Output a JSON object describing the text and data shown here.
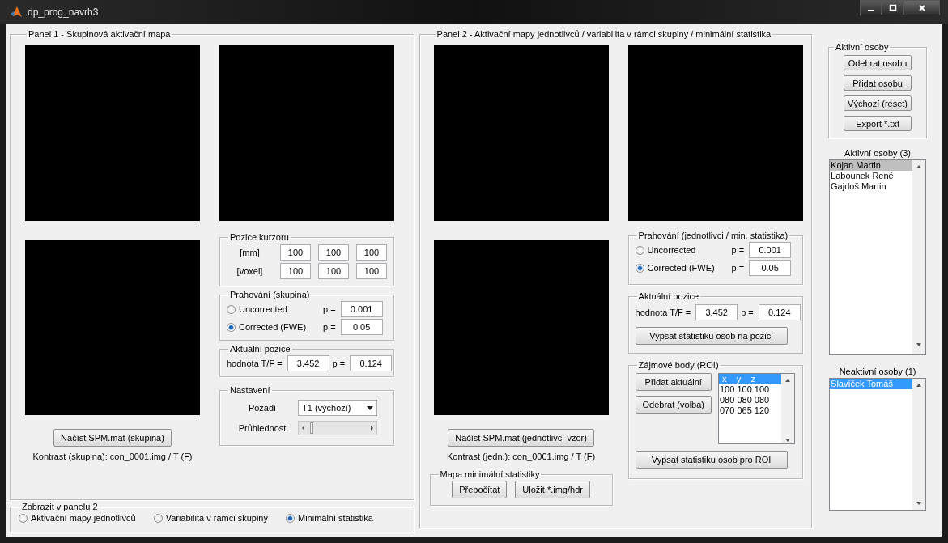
{
  "window": {
    "title": "dp_prog_navrh3"
  },
  "panel1": {
    "title": "Panel 1 - Skupinová aktivační mapa",
    "load_button": "Načíst SPM.mat (skupina)",
    "contrast": "Kontrast (skupina): con_0001.img / T (F)",
    "cursor": {
      "title": "Pozice kurzoru",
      "rows": [
        {
          "label": "[mm]",
          "values": [
            "100",
            "100",
            "100"
          ]
        },
        {
          "label": "[voxel]",
          "values": [
            "100",
            "100",
            "100"
          ]
        }
      ]
    },
    "threshold": {
      "title": "Prahování (skupina)",
      "options": [
        {
          "label": "Uncorrected",
          "selected": false,
          "p_label": "p =",
          "p": "0.001"
        },
        {
          "label": "Corrected (FWE)",
          "selected": true,
          "p_label": "p =",
          "p": "0.05"
        }
      ]
    },
    "current": {
      "title": "Aktuální pozice",
      "value_label": "hodnota T/F =",
      "value": "3.452",
      "p_label": "p =",
      "p": "0.124"
    },
    "settings": {
      "title": "Nastavení",
      "background_label": "Pozadí",
      "background": "T1 (výchozí)",
      "opacity_label": "Průhlednost"
    }
  },
  "display": {
    "title": "Zobrazit v panelu 2",
    "options": [
      {
        "label": "Aktivační mapy jednotlivců",
        "selected": false
      },
      {
        "label": "Variabilita v rámci skupiny",
        "selected": false
      },
      {
        "label": "Minimální statistika",
        "selected": true
      }
    ]
  },
  "panel2": {
    "title": "Panel 2 - Aktivační mapy jednotlivců / variabilita v rámci skupiny / minimální statistika",
    "load_button": "Načíst SPM.mat (jednotlivci-vzor)",
    "contrast": "Kontrast (jedn.): con_0001.img / T (F)",
    "min_map": {
      "title": "Mapa minimální statistiky",
      "buttons": [
        "Přepočítat",
        "Uložit *.img/hdr"
      ]
    },
    "threshold": {
      "title": "Prahování (jednotlivci / min. statistika)",
      "options": [
        {
          "label": "Uncorrected",
          "selected": false,
          "p_label": "p =",
          "p": "0.001"
        },
        {
          "label": "Corrected (FWE)",
          "selected": true,
          "p_label": "p =",
          "p": "0.05"
        }
      ]
    },
    "current": {
      "title": "Aktuální pozice",
      "value_label": "hodnota T/F =",
      "value": "3.452",
      "p_label": "p =",
      "p": "0.124",
      "button": "Vypsat statistiku osob na pozici"
    },
    "roi": {
      "title": "Zájmové body (ROI)",
      "buttons": [
        "Přidat aktuální",
        "Odebrat (volba)"
      ],
      "items": [
        {
          "text": " x    y    z",
          "selected": true
        },
        {
          "text": "100 100 100",
          "selected": false
        },
        {
          "text": "080 080 080",
          "selected": false
        },
        {
          "text": "070 065 120",
          "selected": false
        }
      ],
      "button": "Vypsat statistiku osob pro ROI"
    }
  },
  "persons": {
    "title": "Aktivní osoby",
    "buttons": [
      "Odebrat osobu",
      "Přidat osobu",
      "Výchozí (reset)",
      "Export *.txt"
    ],
    "active": {
      "label": "Aktivní osoby (3)",
      "focused": false,
      "items": [
        {
          "name": "Kojan Martin",
          "selected": true
        },
        {
          "name": "Labounek René",
          "selected": false
        },
        {
          "name": "Gajdoš Martin",
          "selected": false
        }
      ]
    },
    "inactive": {
      "label": "Neaktivní osoby (1)",
      "focused": true,
      "items": [
        {
          "name": "Slavíček Tomáš",
          "selected": true
        }
      ]
    }
  }
}
